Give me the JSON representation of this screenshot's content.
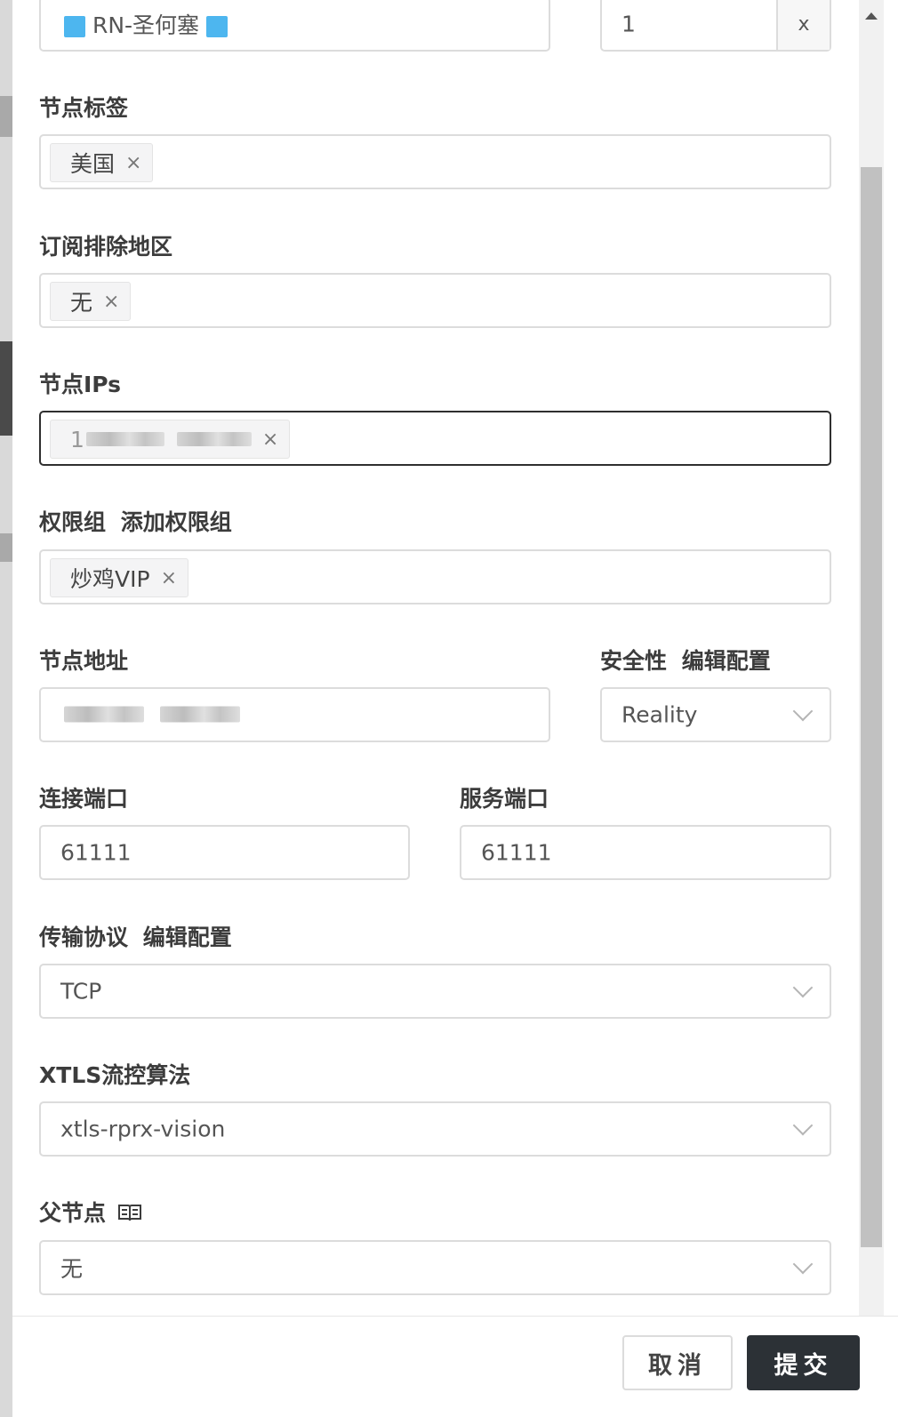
{
  "node_name": {
    "value": "RN-圣何塞"
  },
  "rate": {
    "value": "1",
    "suffix": "x"
  },
  "tags": {
    "label": "节点标签",
    "items": [
      "美国"
    ]
  },
  "exclude_regions": {
    "label": "订阅排除地区",
    "items": [
      "无"
    ]
  },
  "ips": {
    "label": "节点IPs",
    "items": [
      "1"
    ]
  },
  "groups": {
    "label": "权限组",
    "link": "添加权限组",
    "items": [
      "炒鸡VIP"
    ]
  },
  "address": {
    "label": "节点地址"
  },
  "security": {
    "label": "安全性",
    "link": "编辑配置",
    "value": "Reality"
  },
  "connect_port": {
    "label": "连接端口",
    "value": "61111"
  },
  "server_port": {
    "label": "服务端口",
    "value": "61111"
  },
  "transport": {
    "label": "传输协议",
    "link": "编辑配置",
    "value": "TCP"
  },
  "flow": {
    "label": "XTLS流控算法",
    "value": "xtls-rprx-vision"
  },
  "parent": {
    "label": "父节点",
    "value": "无",
    "icon": "book-icon"
  },
  "footer": {
    "cancel": "取消",
    "submit": "提交"
  },
  "tag_close_glyph": "×",
  "colors": {
    "accent_square": "#4db6ef",
    "submit_bg": "#2c3136"
  }
}
